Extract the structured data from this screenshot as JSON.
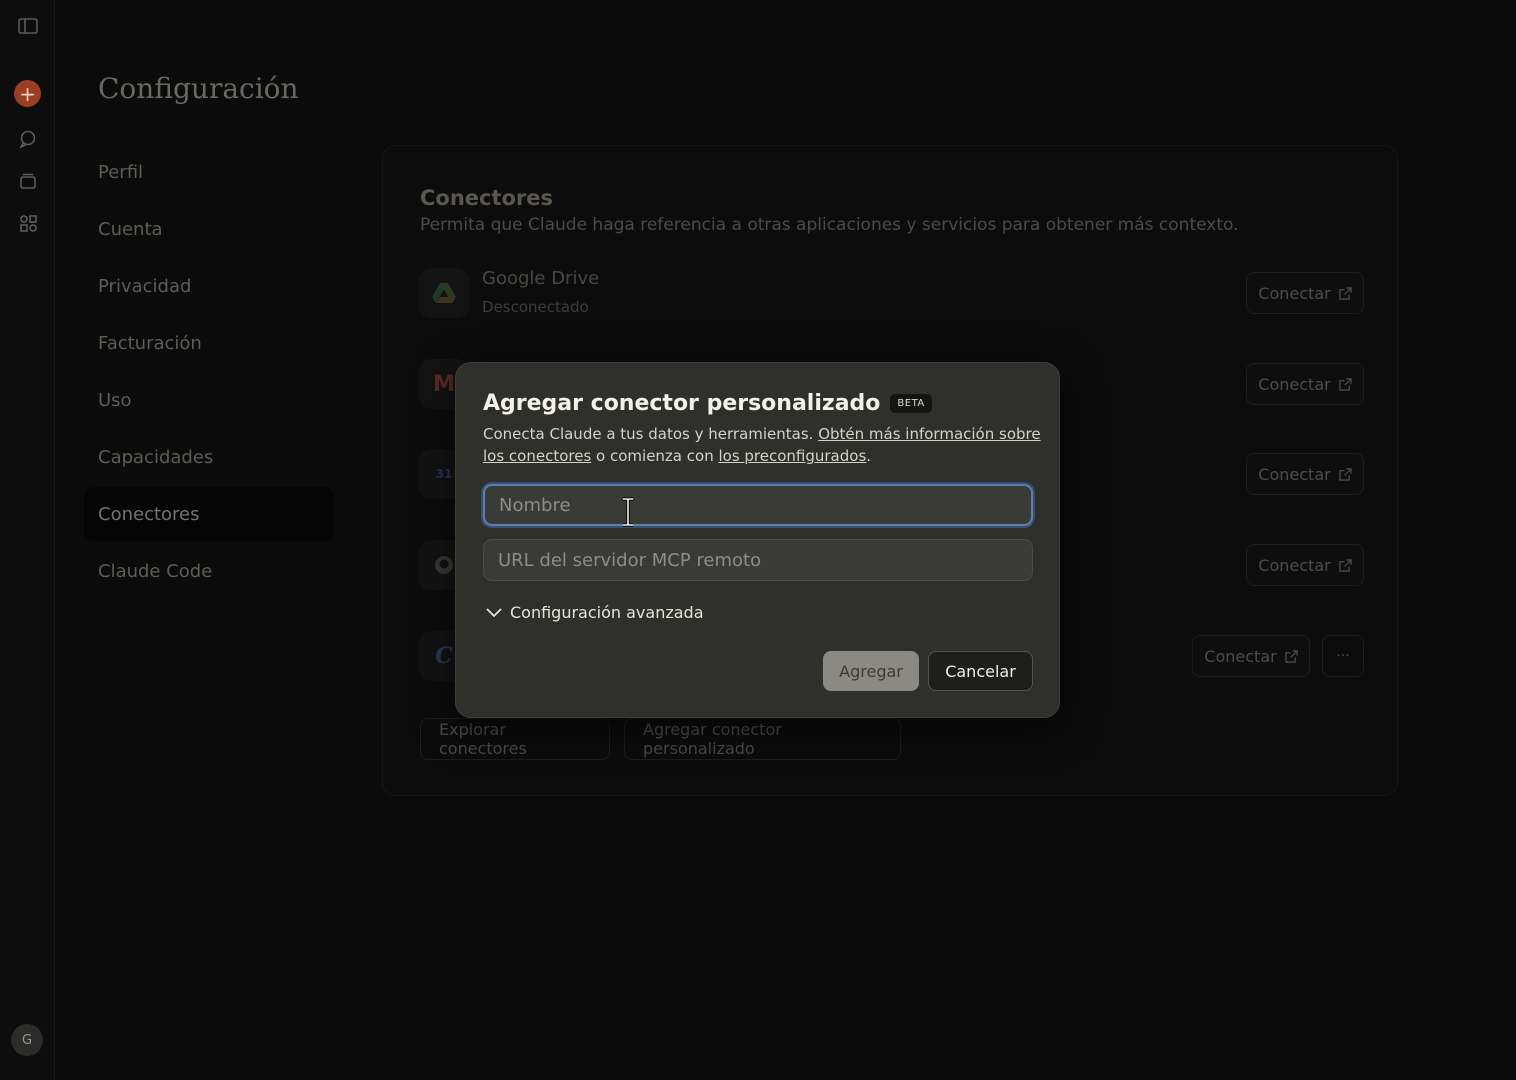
{
  "rail": {
    "avatar_initial": "G",
    "icons": [
      "sidebar-toggle-icon",
      "new-chat-icon",
      "chats-icon",
      "projects-icon",
      "artifacts-icon"
    ]
  },
  "page": {
    "title": "Configuración",
    "nav": [
      {
        "label": "Perfil"
      },
      {
        "label": "Cuenta"
      },
      {
        "label": "Privacidad"
      },
      {
        "label": "Facturación"
      },
      {
        "label": "Uso"
      },
      {
        "label": "Capacidades"
      },
      {
        "label": "Conectores",
        "active": true
      },
      {
        "label": "Claude Code"
      }
    ]
  },
  "connectors": {
    "title": "Conectores",
    "description": "Permita que Claude haga referencia a otras aplicaciones y servicios para obtener más contexto.",
    "items": [
      {
        "name": "Google Drive",
        "status": "Desconectado",
        "button": "Conectar",
        "icon": "google-drive-icon"
      },
      {
        "name": "",
        "status": "",
        "button": "Conectar",
        "icon": "gmail-icon"
      },
      {
        "name": "",
        "status": "",
        "button": "Conectar",
        "icon": "google-calendar-icon"
      },
      {
        "name": "",
        "status": "",
        "button": "Conectar",
        "icon": "github-icon"
      },
      {
        "name": "",
        "status": "",
        "button": "Conectar",
        "icon": "canva-icon",
        "more": "···"
      }
    ],
    "explore_button": "Explorar conectores",
    "add_custom_button": "Agregar conector personalizado"
  },
  "modal": {
    "title": "Agregar conector personalizado",
    "badge": "BETA",
    "desc_prefix": "Conecta Claude a tus datos y herramientas. ",
    "desc_link1": "Obtén más información sobre los conectores",
    "desc_middle": " o comienza con ",
    "desc_link2": "los preconfigurados",
    "desc_suffix": ".",
    "name_placeholder": "Nombre",
    "url_placeholder": "URL del servidor MCP remoto",
    "advanced_label": "Configuración avanzada",
    "add_label": "Agregar",
    "cancel_label": "Cancelar"
  },
  "colors": {
    "modal_bg": "#2f2f2c",
    "focus_ring": "#5b7fb0",
    "new_chat": "#9a3f22"
  }
}
